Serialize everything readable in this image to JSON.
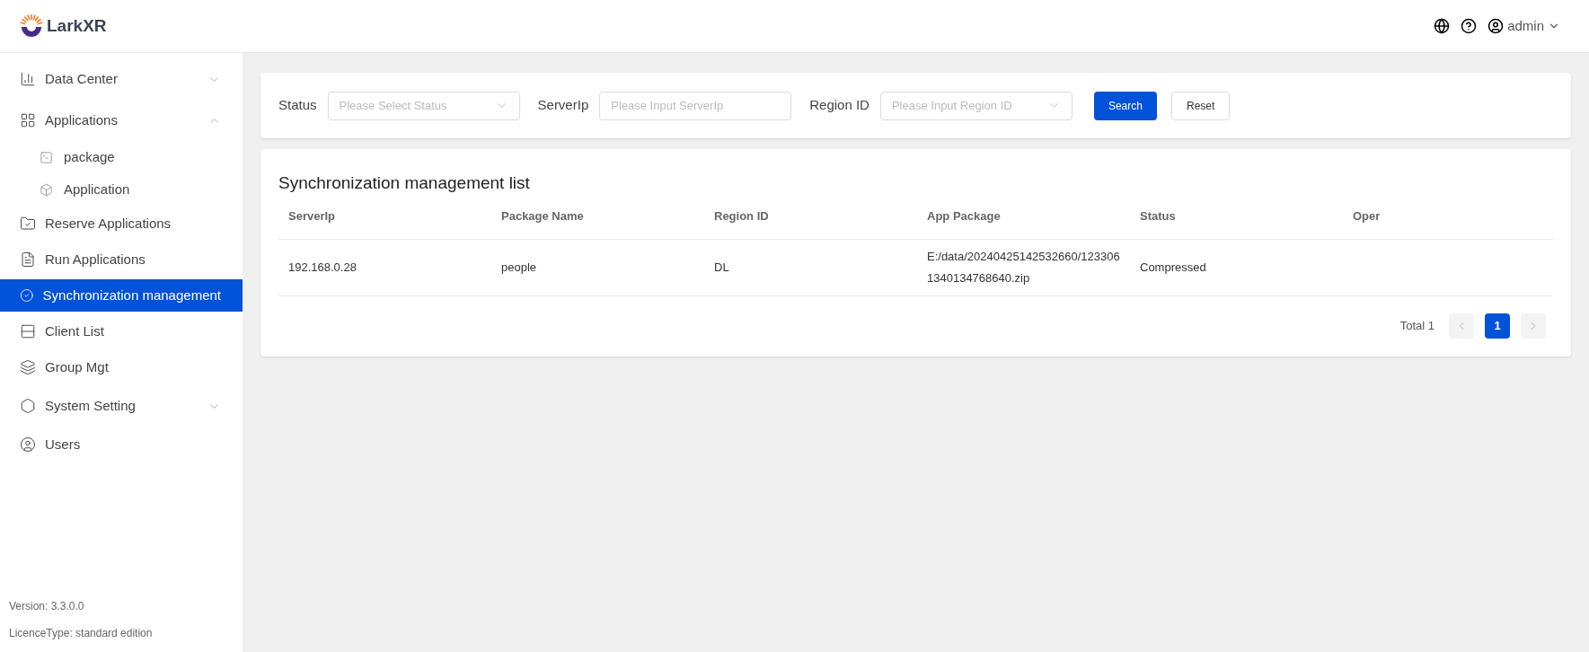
{
  "header": {
    "logo_text": "LarkXR",
    "user": "admin"
  },
  "sidebar": {
    "items": [
      {
        "kind": "group",
        "label": "Data Center",
        "expanded": false,
        "selected": false
      },
      {
        "kind": "group",
        "label": "Applications",
        "expanded": true,
        "selected": false,
        "children": [
          {
            "label": "package",
            "selected": false
          },
          {
            "label": "Application",
            "selected": false
          }
        ]
      },
      {
        "kind": "item",
        "label": "Reserve Applications",
        "selected": false
      },
      {
        "kind": "item",
        "label": "Run Applications",
        "selected": false
      },
      {
        "kind": "item",
        "label": "Synchronization management",
        "selected": true
      },
      {
        "kind": "item",
        "label": "Client List",
        "selected": false
      },
      {
        "kind": "item",
        "label": "Group Mgt",
        "selected": false
      },
      {
        "kind": "group",
        "label": "System Setting",
        "expanded": false,
        "selected": false
      },
      {
        "kind": "item",
        "label": "Users",
        "selected": false
      }
    ],
    "version": "Version: 3.3.0.0",
    "licence": "LicenceType: standard edition"
  },
  "filters": [
    {
      "kind": "select",
      "label": "Status",
      "placeholder": "Please Select Status"
    },
    {
      "kind": "input",
      "label": "ServerIp",
      "placeholder": "Please Input ServerIp"
    },
    {
      "kind": "select",
      "label": "Region ID",
      "placeholder": "Please Input Region ID"
    }
  ],
  "buttons": [
    {
      "label": "Search",
      "primary": true
    },
    {
      "label": "Reset",
      "primary": false
    }
  ],
  "table": {
    "title": "Synchronization management list",
    "columns": [
      "ServerIp",
      "Package Name",
      "Region ID",
      "App Package",
      "Status",
      "Oper"
    ],
    "rows": [
      [
        "192.168.0.28",
        "people",
        "DL",
        "E:/data/20240425142532660/1233061340134768640.zip",
        "Compressed"
      ]
    ]
  },
  "pagination": {
    "total": "Total 1",
    "prev_disabled": true,
    "next_disabled": true,
    "pages": [
      {
        "label": "1",
        "selected": true
      }
    ]
  }
}
